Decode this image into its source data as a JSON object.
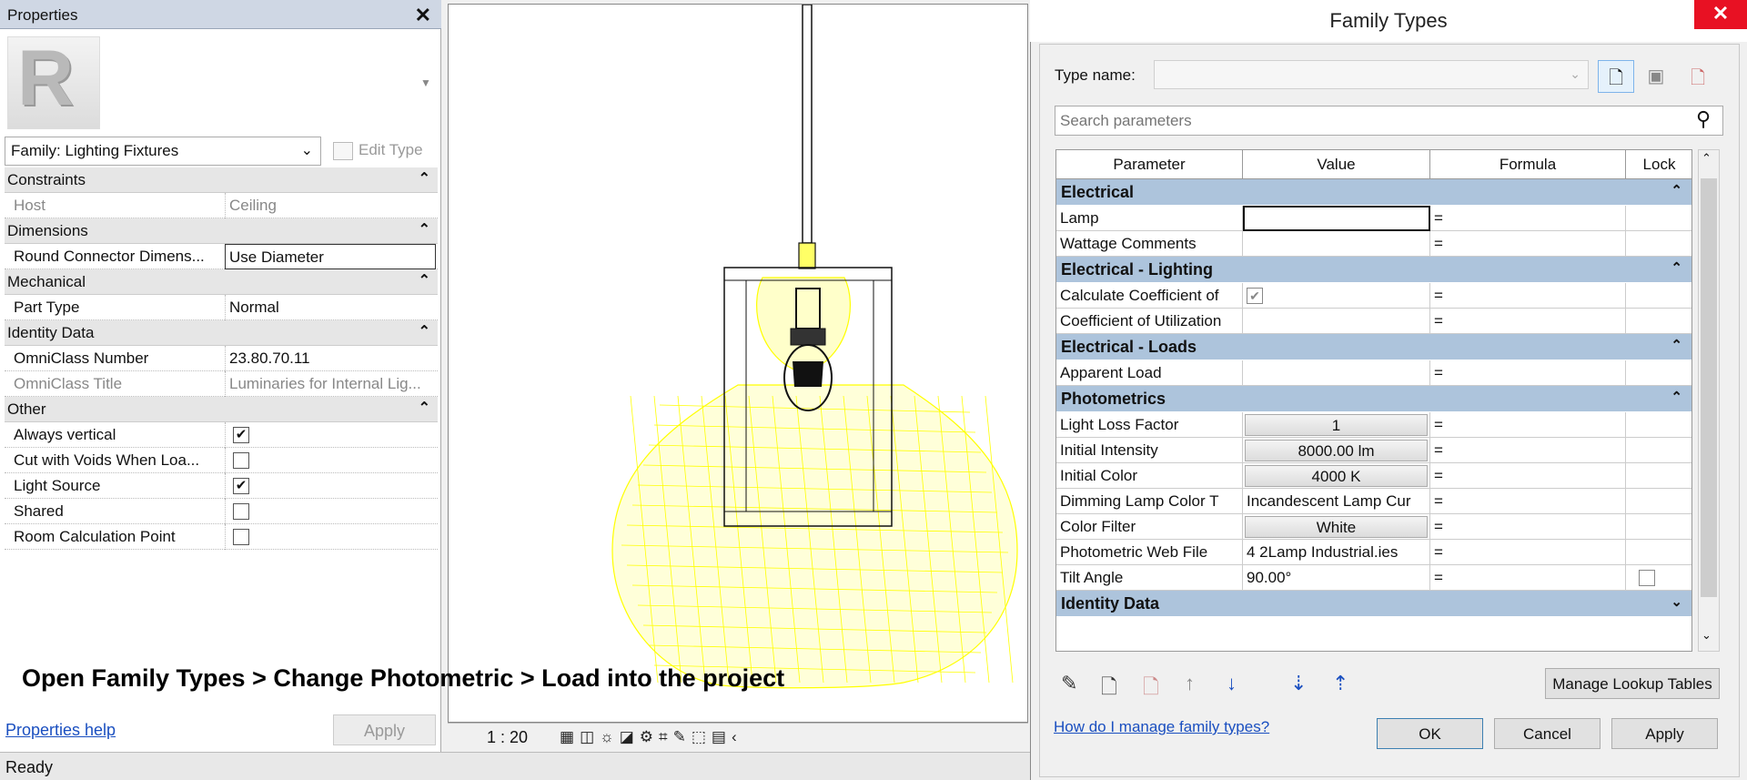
{
  "properties": {
    "title": "Properties",
    "family_select": "Family: Lighting Fixtures",
    "edit_type": "Edit Type",
    "sections": [
      {
        "name": "Constraints",
        "rows": [
          {
            "label": "Host",
            "value": "Ceiling",
            "grey": true
          }
        ]
      },
      {
        "name": "Dimensions",
        "rows": [
          {
            "label": "Round Connector Dimens...",
            "value": "Use Diameter"
          }
        ]
      },
      {
        "name": "Mechanical",
        "rows": [
          {
            "label": "Part Type",
            "value": "Normal"
          }
        ]
      },
      {
        "name": "Identity Data",
        "rows": [
          {
            "label": "OmniClass Number",
            "value": "23.80.70.11"
          },
          {
            "label": "OmniClass Title",
            "value": "Luminaries for Internal Lig...",
            "grey": true
          }
        ]
      },
      {
        "name": "Other",
        "rows": [
          {
            "label": "Always vertical",
            "checked": true
          },
          {
            "label": "Cut with Voids When Loa...",
            "checked": false
          },
          {
            "label": "Light Source",
            "checked": true
          },
          {
            "label": "Shared",
            "checked": false
          },
          {
            "label": "Room Calculation Point",
            "checked": false
          }
        ]
      }
    ],
    "help_link": "Properties help",
    "apply": "Apply"
  },
  "viewport": {
    "caption": "Open Family Types > Change Photometric > Load into the project",
    "scale": "1 : 20",
    "colors": {
      "photometric_web": "#ffff00"
    }
  },
  "status": "Ready",
  "dialog": {
    "title": "Family Types",
    "type_name_label": "Type name:",
    "type_name_value": "",
    "search_placeholder": "Search parameters",
    "columns": [
      "Parameter",
      "Value",
      "Formula",
      "Lock"
    ],
    "groups": [
      {
        "name": "Electrical",
        "rows": [
          {
            "p": "Lamp",
            "v": "",
            "f": "=",
            "edit": true
          },
          {
            "p": "Wattage Comments",
            "v": "",
            "f": "="
          }
        ]
      },
      {
        "name": "Electrical - Lighting",
        "rows": [
          {
            "p": "Calculate Coefficient of",
            "v": "",
            "f": "=",
            "check": true
          },
          {
            "p": "Coefficient of Utilization",
            "v": "",
            "f": "="
          }
        ]
      },
      {
        "name": "Electrical - Loads",
        "rows": [
          {
            "p": "Apparent Load",
            "v": "",
            "f": "="
          }
        ]
      },
      {
        "name": "Photometrics",
        "rows": [
          {
            "p": "Light Loss Factor",
            "v": "1",
            "f": "=",
            "btn": true
          },
          {
            "p": "Initial Intensity",
            "v": "8000.00 lm",
            "f": "=",
            "btn": true
          },
          {
            "p": "Initial Color",
            "v": "4000 K",
            "f": "=",
            "btn": true
          },
          {
            "p": "Dimming Lamp Color T",
            "v": "Incandescent Lamp Cur",
            "f": "="
          },
          {
            "p": "Color Filter",
            "v": "White",
            "f": "=",
            "btn": true
          },
          {
            "p": "Photometric Web File",
            "v": "4 2Lamp Industrial.ies",
            "f": "="
          },
          {
            "p": "Tilt Angle",
            "v": "90.00°",
            "f": "=",
            "lock": true
          }
        ]
      },
      {
        "name": "Identity Data",
        "rows": [],
        "collapsed": true
      }
    ],
    "manage_lookup": "Manage Lookup Tables",
    "help_link": "How do I manage family types?",
    "ok": "OK",
    "cancel": "Cancel",
    "apply": "Apply"
  }
}
